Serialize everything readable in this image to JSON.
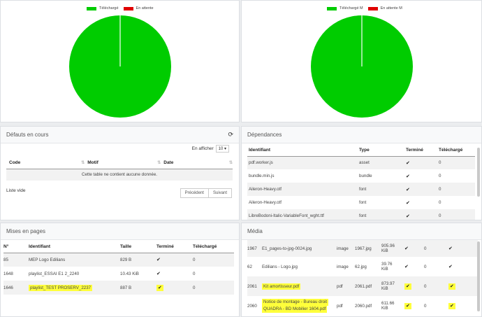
{
  "charts": {
    "left": {
      "legend": [
        {
          "label": "Téléchargé",
          "color": "#00cc00"
        },
        {
          "label": "En attente",
          "color": "#e00000"
        }
      ]
    },
    "right": {
      "legend": [
        {
          "label": "Téléchargé M",
          "color": "#00cc00"
        },
        {
          "label": "En attente M",
          "color": "#e00000"
        }
      ]
    }
  },
  "chart_data": [
    {
      "type": "pie",
      "labels": [
        "Téléchargé",
        "En attente"
      ],
      "values": [
        100,
        0
      ],
      "colors": [
        "#00cc00",
        "#e00000"
      ],
      "legend": "top"
    },
    {
      "type": "pie",
      "labels": [
        "Téléchargé M",
        "En attente M"
      ],
      "values": [
        100,
        0
      ],
      "colors": [
        "#00cc00",
        "#e00000"
      ],
      "legend": "top"
    }
  ],
  "defauts": {
    "title": "Défauts en cours",
    "refresh_icon": "refresh-icon",
    "show_label": "En afficher",
    "show_value": "10",
    "columns": [
      "Code",
      "Motif",
      "Date"
    ],
    "empty": "Cette table ne contient aucune donnée.",
    "list_status": "Liste vide",
    "prev": "Précédent",
    "next": "Suivant"
  },
  "dependances": {
    "title": "Dépendances",
    "columns": [
      "Identifiant",
      "Type",
      "Terminé",
      "Téléchargé"
    ],
    "rows": [
      {
        "id": "pdf.worker.js",
        "type": "asset",
        "done": "✔",
        "dl": "0"
      },
      {
        "id": "bundle.min.js",
        "type": "bundle",
        "done": "✔",
        "dl": "0"
      },
      {
        "id": "Aileron-Heavy.otf",
        "type": "font",
        "done": "✔",
        "dl": "0"
      },
      {
        "id": "Aileron-Heavy.otf",
        "type": "font",
        "done": "✔",
        "dl": "0"
      },
      {
        "id": "LibreBodoni-Italic-VariableFont_wght.ttf",
        "type": "font",
        "done": "✔",
        "dl": "0"
      }
    ]
  },
  "mises": {
    "title": "Mises en pages",
    "columns": [
      "N°",
      "Identifiant",
      "Taille",
      "Terminé",
      "Téléchargé"
    ],
    "rows": [
      {
        "n": "85",
        "id": "MEP Logo Edilians",
        "size": "829 B",
        "done": "✔",
        "dl": "0"
      },
      {
        "n": "1648",
        "id": "playlist_ESSAI E1 2_2240",
        "size": "10.43 KiB",
        "done": "✔",
        "dl": "0"
      },
      {
        "n": "1646",
        "id": "playlist_TEST PROSERV_2237",
        "size": "887 B",
        "done": "✔",
        "dl": "0"
      }
    ]
  },
  "media": {
    "title": "Média",
    "rows": [
      {
        "n": "1967",
        "id": "E1_pages-to-jpg-0024.jpg",
        "type": "image",
        "file": "1967.jpg",
        "size1": "905.96",
        "size2": "KiB",
        "done": "✔",
        "dl": "0",
        "extra": "✔"
      },
      {
        "n": "62",
        "id": "Edilians - Logo.jpg",
        "type": "image",
        "file": "62.jpg",
        "size1": "39.76",
        "size2": "KiB",
        "done": "✔",
        "dl": "0",
        "extra": "✔"
      },
      {
        "n": "2061",
        "id": "Kit amortisseur.pdf",
        "type": "pdf",
        "file": "2061.pdf",
        "size1": "873.97",
        "size2": "KiB",
        "done": "✔",
        "dl": "0",
        "extra": "✔"
      },
      {
        "n": "2060",
        "id1": "Notice de montage - Bureau droit",
        "id2": "QUADRA - BD Mobilier 1604.pdf",
        "type": "pdf",
        "file": "2060.pdf",
        "size1": "611.66",
        "size2": "KiB",
        "done": "✔",
        "dl": "0",
        "extra": "✔"
      }
    ]
  }
}
